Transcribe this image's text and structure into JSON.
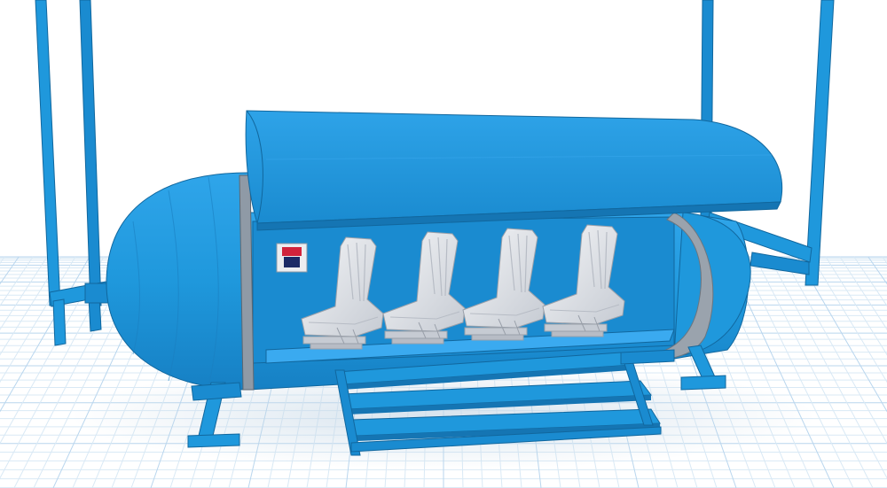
{
  "scene": {
    "description_visible_text": "",
    "colors": {
      "background": "#ffffff",
      "grid_minor": "#d9e9f5",
      "grid_major": "#b9d6ee",
      "model_primary": "#1f98dc",
      "model_shade": "#1a7fc0",
      "model_dark": "#11679e",
      "model_highlight": "#3aaaf0",
      "seat": "#e6e9ee",
      "seat_shade": "#b7bcc5",
      "door_ring": "#9aa3ad",
      "panel_red": "#d1233c",
      "panel_navy": "#1c2a66"
    },
    "objects": [
      "pod-capsule",
      "canopy",
      "seats",
      "steps",
      "support-frames",
      "workplane-grid"
    ]
  }
}
